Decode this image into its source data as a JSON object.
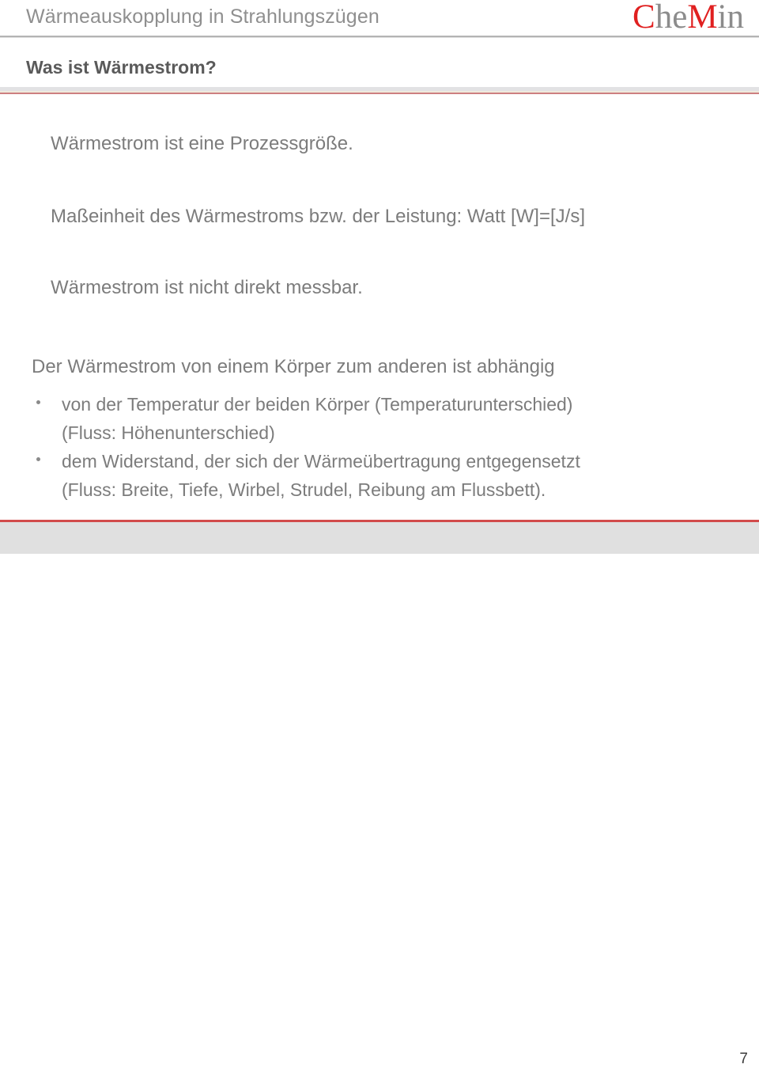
{
  "header": {
    "title": "Wärmeauskopplung in Strahlungszügen",
    "logo": {
      "part1": "C",
      "part2": "he",
      "part3": "M",
      "part4": "in",
      "red": "#e02020",
      "gray": "#8c8c8c"
    }
  },
  "slide": {
    "title": "Was ist Wärmestrom?",
    "paragraphs": [
      "Wärmestrom ist eine Prozessgröße.",
      "Maßeinheit des Wärmestroms bzw. der Leistung: Watt [W]=[J/s]",
      "Wärmestrom ist nicht direkt messbar.",
      "Der Wärmestrom von einem Körper zum anderen ist abhängig"
    ],
    "bullets": [
      {
        "text": "von der Temperatur der beiden Körper (Temperaturunterschied)",
        "sub": "(Fluss: Höhenunterschied)"
      },
      {
        "text": "dem Widerstand, der sich der Wärmeübertragung entgegensetzt",
        "sub": "(Fluss: Breite, Tiefe, Wirbel, Strudel, Reibung am Flussbett)."
      }
    ]
  },
  "footer": {
    "page_number": "7",
    "accent_color": "#d24b4b",
    "band_color": "#e0e0e0"
  }
}
